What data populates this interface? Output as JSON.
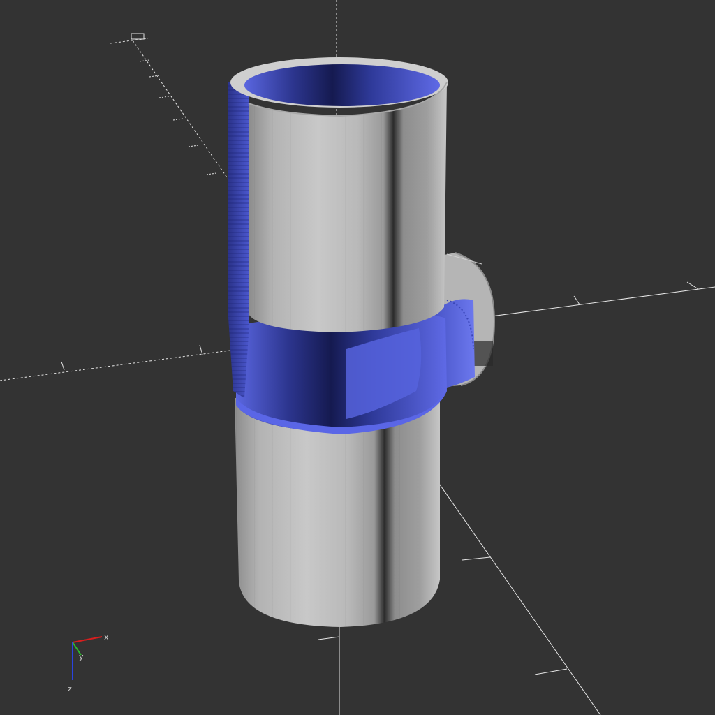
{
  "viewport": {
    "background": "#333333",
    "model_color": "#bdbdbd",
    "cut_face_color": "#4e5ad8",
    "axis_color": "#e6e6e6"
  },
  "axes_gizmo": {
    "x_label": "x",
    "y_label": "y",
    "z_label": "z",
    "x_color": "#d81e1e",
    "y_color": "#2eb82e",
    "z_color": "#2a44e0"
  }
}
